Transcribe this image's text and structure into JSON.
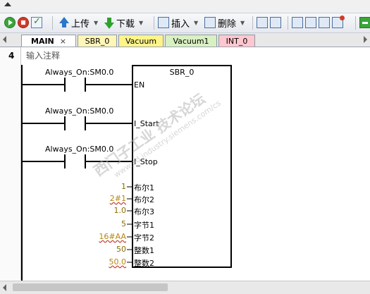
{
  "toolbar": {
    "upload_label": "上传",
    "download_label": "下载",
    "insert_label": "插入",
    "delete_label": "删除",
    "dropdown_caret": "▼"
  },
  "tabs": [
    {
      "label": "MAIN",
      "close": "×",
      "color": "#ffffff"
    },
    {
      "label": "SBR_0",
      "color": "#fff6b8"
    },
    {
      "label": "Vacuum",
      "color": "#fff48a"
    },
    {
      "label": "Vacuum1",
      "color": "#d9f0c2"
    },
    {
      "label": "INT_0",
      "color": "#ffc7cf"
    }
  ],
  "network": {
    "number": "4",
    "comment": "输入注释",
    "contacts": [
      "Always_On:SM0.0",
      "Always_On:SM0.0",
      "Always_On:SM0.0"
    ],
    "box": {
      "title": "SBR_0",
      "pins": [
        "EN",
        "I_Start",
        "I_Stop",
        "布尔1",
        "布尔2",
        "布尔3",
        "字节1",
        "字节2",
        "整数1",
        "整数2"
      ]
    },
    "operands": [
      "1",
      "2#1",
      "1.0",
      "5",
      "16#AA",
      "50",
      "50.0"
    ]
  },
  "watermark": {
    "line1": "西门子工业  技术论坛",
    "line2": "www.ad.industry.siemens.com/cs"
  }
}
